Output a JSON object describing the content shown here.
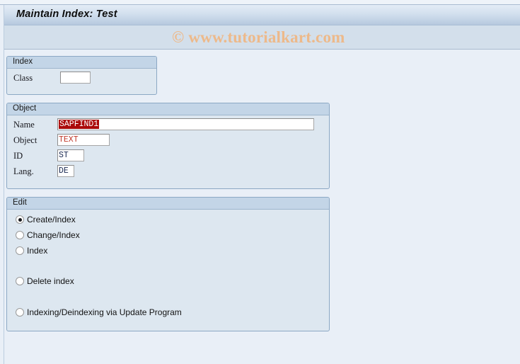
{
  "window": {
    "title": "Maintain Index: Test",
    "watermark": "© www.tutorialkart.com"
  },
  "index_panel": {
    "title": "Index",
    "class_label": "Class",
    "class_value": ""
  },
  "object_panel": {
    "title": "Object",
    "fields": [
      {
        "label": "Name",
        "value": "SAPFIND1",
        "selected": true,
        "red": false
      },
      {
        "label": "Object",
        "value": "TEXT",
        "selected": false,
        "red": true
      },
      {
        "label": "ID",
        "value": "ST",
        "selected": false,
        "red": false
      },
      {
        "label": "Lang.",
        "value": "DE",
        "selected": false,
        "red": false
      }
    ]
  },
  "edit_panel": {
    "title": "Edit",
    "options": [
      {
        "label": "Create/Index",
        "checked": true
      },
      {
        "label": "Change/Index",
        "checked": false
      },
      {
        "label": "Index",
        "checked": false
      },
      {
        "label": "Delete index",
        "checked": false
      },
      {
        "label": "Indexing/Deindexing via Update Program",
        "checked": false
      }
    ]
  },
  "colors": {
    "page_background": "#e9eff7",
    "panel_background": "#dde7f0",
    "panel_header": "#c3d5e7",
    "panel_border": "#8ca8c4",
    "titlebar_gradient_top": "#e3ecf6",
    "titlebar_gradient_bottom": "#aabfd6",
    "watermark_band": "#d3dfeb",
    "watermark_text": "#edb98a",
    "selection_highlight": "#ab0a0a",
    "selection_text": "#ffffff",
    "input_red_text": "#c0392b",
    "input_text": "#1b2a52"
  }
}
